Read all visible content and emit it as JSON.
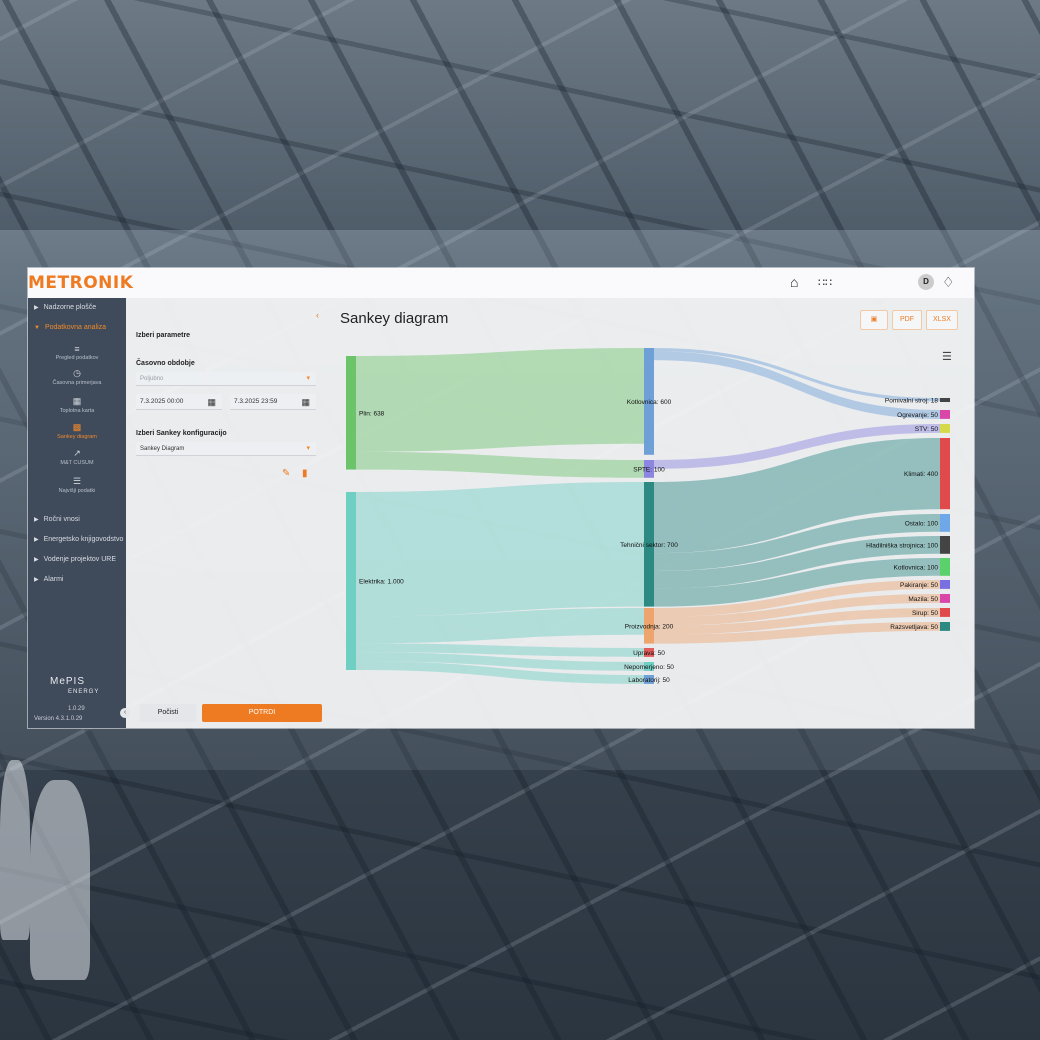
{
  "brand": {
    "logo": "METRONIK",
    "accent": "#ee7a22"
  },
  "topbar": {
    "home_icon": "home-icon",
    "apps_icon": "grid-icon",
    "avatar": "D",
    "bell_icon": "bell-icon"
  },
  "nav": {
    "items": [
      {
        "label": "Nadzorne plošče"
      },
      {
        "label": "Podatkovna analiza"
      },
      {
        "label": "Ročni vnosi"
      },
      {
        "label": "Energetsko knjigovodstvo"
      },
      {
        "label": "Vodenje projektov URE"
      },
      {
        "label": "Alarmi"
      }
    ],
    "subitems": [
      {
        "label": "Pregled podatkov",
        "icon": "list-icon"
      },
      {
        "label": "Časovna primerjava",
        "icon": "clock-icon"
      },
      {
        "label": "Toplotna karta",
        "icon": "heatmap-icon"
      },
      {
        "label": "Sankey diagram",
        "icon": "chart-icon"
      },
      {
        "label": "M&T CUSUM",
        "icon": "trend-icon"
      },
      {
        "label": "Najvišji podatki",
        "icon": "bars-icon"
      }
    ],
    "product_line1": "MePIS",
    "product_line2": "ENERGY",
    "version": "1.0.29",
    "version_full": "Version 4.3.1.0.29"
  },
  "params": {
    "heading": "Izberi parametre",
    "period_label": "Časovno obdobje",
    "period_placeholder": "Poljubno",
    "date_from": "7.3.2025 00:00",
    "date_to": "7.3.2025 23:59",
    "config_label": "Izberi Sankey konfiguracijo",
    "config_value": "Sankey Diagram",
    "clear_button": "Počisti",
    "confirm_button": "POTRDI"
  },
  "main": {
    "title": "Sankey diagram",
    "pdf_button": "PDF",
    "xlsx_button": "XLSX",
    "save_icon": "save-icon",
    "menu_icon": "menu-icon"
  },
  "chart_data": {
    "type": "sankey",
    "nodes": [
      {
        "id": "plin",
        "label": "Plin: 638",
        "color": "#6cc46a"
      },
      {
        "id": "elektrika",
        "label": "Elektrika: 1.000",
        "color": "#6fcfc3"
      },
      {
        "id": "kotlovnica",
        "label": "Kotlovnica: 600",
        "color": "#6e9fd6"
      },
      {
        "id": "spte",
        "label": "SPTE: 100",
        "color": "#8c86e0"
      },
      {
        "id": "tehnicni",
        "label": "Tehnični sektor: 700",
        "color": "#2c8a83"
      },
      {
        "id": "proizvodnja",
        "label": "Proizvodnja: 200",
        "color": "#eda56d"
      },
      {
        "id": "uprava",
        "label": "Uprava: 50",
        "color": "#e25c5c"
      },
      {
        "id": "nepomerjeno",
        "label": "Nepomerjeno: 50",
        "color": "#6fcfc3"
      },
      {
        "id": "laboratorij",
        "label": "Laboratorij: 50",
        "color": "#6e9fd6"
      },
      {
        "id": "pomivalni",
        "label": "Pomivalni stroj: 18",
        "color": "#444444"
      },
      {
        "id": "ogrevanje",
        "label": "Ogrevanje: 50",
        "color": "#d946a8"
      },
      {
        "id": "stv",
        "label": "STV: 50",
        "color": "#d6d94a"
      },
      {
        "id": "klimati",
        "label": "Klimati: 400",
        "color": "#e04a4a"
      },
      {
        "id": "ostalo",
        "label": "Ostalo: 100",
        "color": "#6ea8e8"
      },
      {
        "id": "hladilniska",
        "label": "Hladilniška strojnica: 100",
        "color": "#444444"
      },
      {
        "id": "kotlovnica2",
        "label": "Kotlovnica: 100",
        "color": "#5ad16a"
      },
      {
        "id": "pakiranje",
        "label": "Pakiranje: 50",
        "color": "#7a6fe0"
      },
      {
        "id": "mazila",
        "label": "Mazila: 50",
        "color": "#d946a8"
      },
      {
        "id": "sirup",
        "label": "Sirup: 50",
        "color": "#e04a4a"
      },
      {
        "id": "razsvetljava",
        "label": "Razsvetljava: 50",
        "color": "#2c8a83"
      }
    ],
    "links": [
      {
        "source": "plin",
        "target": "kotlovnica",
        "value": 538
      },
      {
        "source": "plin",
        "target": "spte",
        "value": 100
      },
      {
        "source": "elektrika",
        "target": "tehnicni",
        "value": 700
      },
      {
        "source": "elektrika",
        "target": "proizvodnja",
        "value": 150
      },
      {
        "source": "elektrika",
        "target": "uprava",
        "value": 50
      },
      {
        "source": "elektrika",
        "target": "nepomerjeno",
        "value": 50
      },
      {
        "source": "elektrika",
        "target": "laboratorij",
        "value": 50
      },
      {
        "source": "kotlovnica",
        "target": "pomivalni",
        "value": 18
      },
      {
        "source": "kotlovnica",
        "target": "ogrevanje",
        "value": 50
      },
      {
        "source": "spte",
        "target": "stv",
        "value": 50
      },
      {
        "source": "tehnicni",
        "target": "klimati",
        "value": 400
      },
      {
        "source": "tehnicni",
        "target": "ostalo",
        "value": 100
      },
      {
        "source": "tehnicni",
        "target": "hladilniska",
        "value": 100
      },
      {
        "source": "tehnicni",
        "target": "kotlovnica2",
        "value": 100
      },
      {
        "source": "proizvodnja",
        "target": "pakiranje",
        "value": 50
      },
      {
        "source": "proizvodnja",
        "target": "mazila",
        "value": 50
      },
      {
        "source": "proizvodnja",
        "target": "sirup",
        "value": 50
      },
      {
        "source": "proizvodnja",
        "target": "razsvetljava",
        "value": 50
      }
    ]
  }
}
